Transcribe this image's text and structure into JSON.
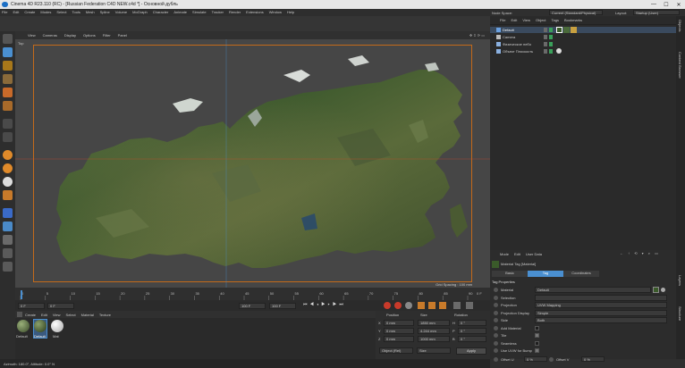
{
  "window": {
    "title": "Cinema 4D R23.110 (RC) - [Russian Federation C4D NEW.c4d *] - Основной дубль",
    "controls": [
      "—",
      "☐",
      "✕"
    ]
  },
  "menubar": [
    "File",
    "Edit",
    "Create",
    "Modes",
    "Select",
    "Tools",
    "Mesh",
    "Spline",
    "Volume",
    "MoGraph",
    "Character",
    "Animate",
    "Simulate",
    "Tracker",
    "Render",
    "Extensions",
    "Window",
    "Help"
  ],
  "node_space": {
    "label": "Node Space:",
    "value": "Current (Standard/Physical)"
  },
  "layout": {
    "label": "Layout:",
    "value": "Startup (User)"
  },
  "viewport": {
    "menu": [
      "View",
      "Cameras",
      "Display",
      "Options",
      "Filter",
      "Panel"
    ],
    "view_label": "Top",
    "grid_spacing": "Grid Spacing : 100 mm"
  },
  "timeline": {
    "ticks": [
      "0",
      "5",
      "10",
      "15",
      "20",
      "25",
      "30",
      "35",
      "40",
      "45",
      "50",
      "55",
      "60",
      "65",
      "70",
      "75",
      "80",
      "85",
      "90"
    ],
    "end_label": "0 F"
  },
  "transport": {
    "current_frame": "0 F",
    "start_frame": "0 F",
    "end_frame_a": "100 F",
    "end_frame_b": "100 F"
  },
  "material_manager": {
    "menu": [
      "Create",
      "Edit",
      "View",
      "Select",
      "Material",
      "Texture"
    ],
    "materials": [
      "Default",
      "Default",
      "Mat"
    ]
  },
  "coordinates": {
    "headers": [
      "Position",
      "Size",
      "Rotation"
    ],
    "rows": [
      {
        "axis": "X",
        "pos": "0 mm",
        "size": "1850 mm",
        "rot_axis": "H",
        "rot": "0 °"
      },
      {
        "axis": "Y",
        "pos": "0 mm",
        "size": "4.244 mm",
        "rot_axis": "P",
        "rot": "0 °"
      },
      {
        "axis": "Z",
        "pos": "0 mm",
        "size": "1000 mm",
        "rot_axis": "B",
        "rot": "0 °"
      }
    ],
    "mode": "Object (Rel)",
    "size_mode": "Size",
    "apply": "Apply"
  },
  "status": "Azimuth: 180.0°, Altitude: 0.0°  N",
  "object_manager": {
    "menu": [
      "File",
      "Edit",
      "View",
      "Object",
      "Tags",
      "Bookmarks"
    ],
    "objects": [
      {
        "name": "Default",
        "icon": "plane-icon"
      },
      {
        "name": "Camera",
        "icon": "camera-icon"
      },
      {
        "name": "Физическое небо",
        "icon": "sky-icon"
      },
      {
        "name": "Объект Плоскость",
        "icon": "floor-icon"
      }
    ]
  },
  "attribute_manager": {
    "menu": [
      "Mode",
      "Edit",
      "User Data"
    ],
    "title": "Material Tag [Material]",
    "tabs": [
      "Basic",
      "Tag",
      "Coordinates"
    ],
    "active_tab": "Tag",
    "section": "Tag Properties",
    "props": [
      {
        "label": "Material",
        "value": "Default",
        "kind": "link"
      },
      {
        "label": "Selection",
        "value": "",
        "kind": "field"
      },
      {
        "label": "Projection",
        "value": "UVW Mapping",
        "kind": "select"
      },
      {
        "label": "Projection Display",
        "value": "Simple",
        "kind": "select"
      },
      {
        "label": "Side",
        "value": "Both",
        "kind": "select"
      },
      {
        "label": "Add Material",
        "value": "",
        "kind": "check"
      },
      {
        "label": "Tile",
        "value": "on",
        "kind": "check"
      },
      {
        "label": "Seamless",
        "value": "",
        "kind": "check"
      },
      {
        "label": "Use UVW for Bump",
        "value": "on",
        "kind": "check"
      }
    ],
    "offset_u": {
      "label": "Offset U",
      "value": "0 %"
    },
    "offset_v": {
      "label": "Offset V",
      "value": "0 %"
    }
  },
  "side_tabs": [
    "Objects",
    "Content Browser",
    "Layers",
    "Structure"
  ],
  "colors": {
    "accent": "#4a8fd0",
    "safe_frame": "#c46a1a",
    "playhead": "#d04a2a"
  }
}
